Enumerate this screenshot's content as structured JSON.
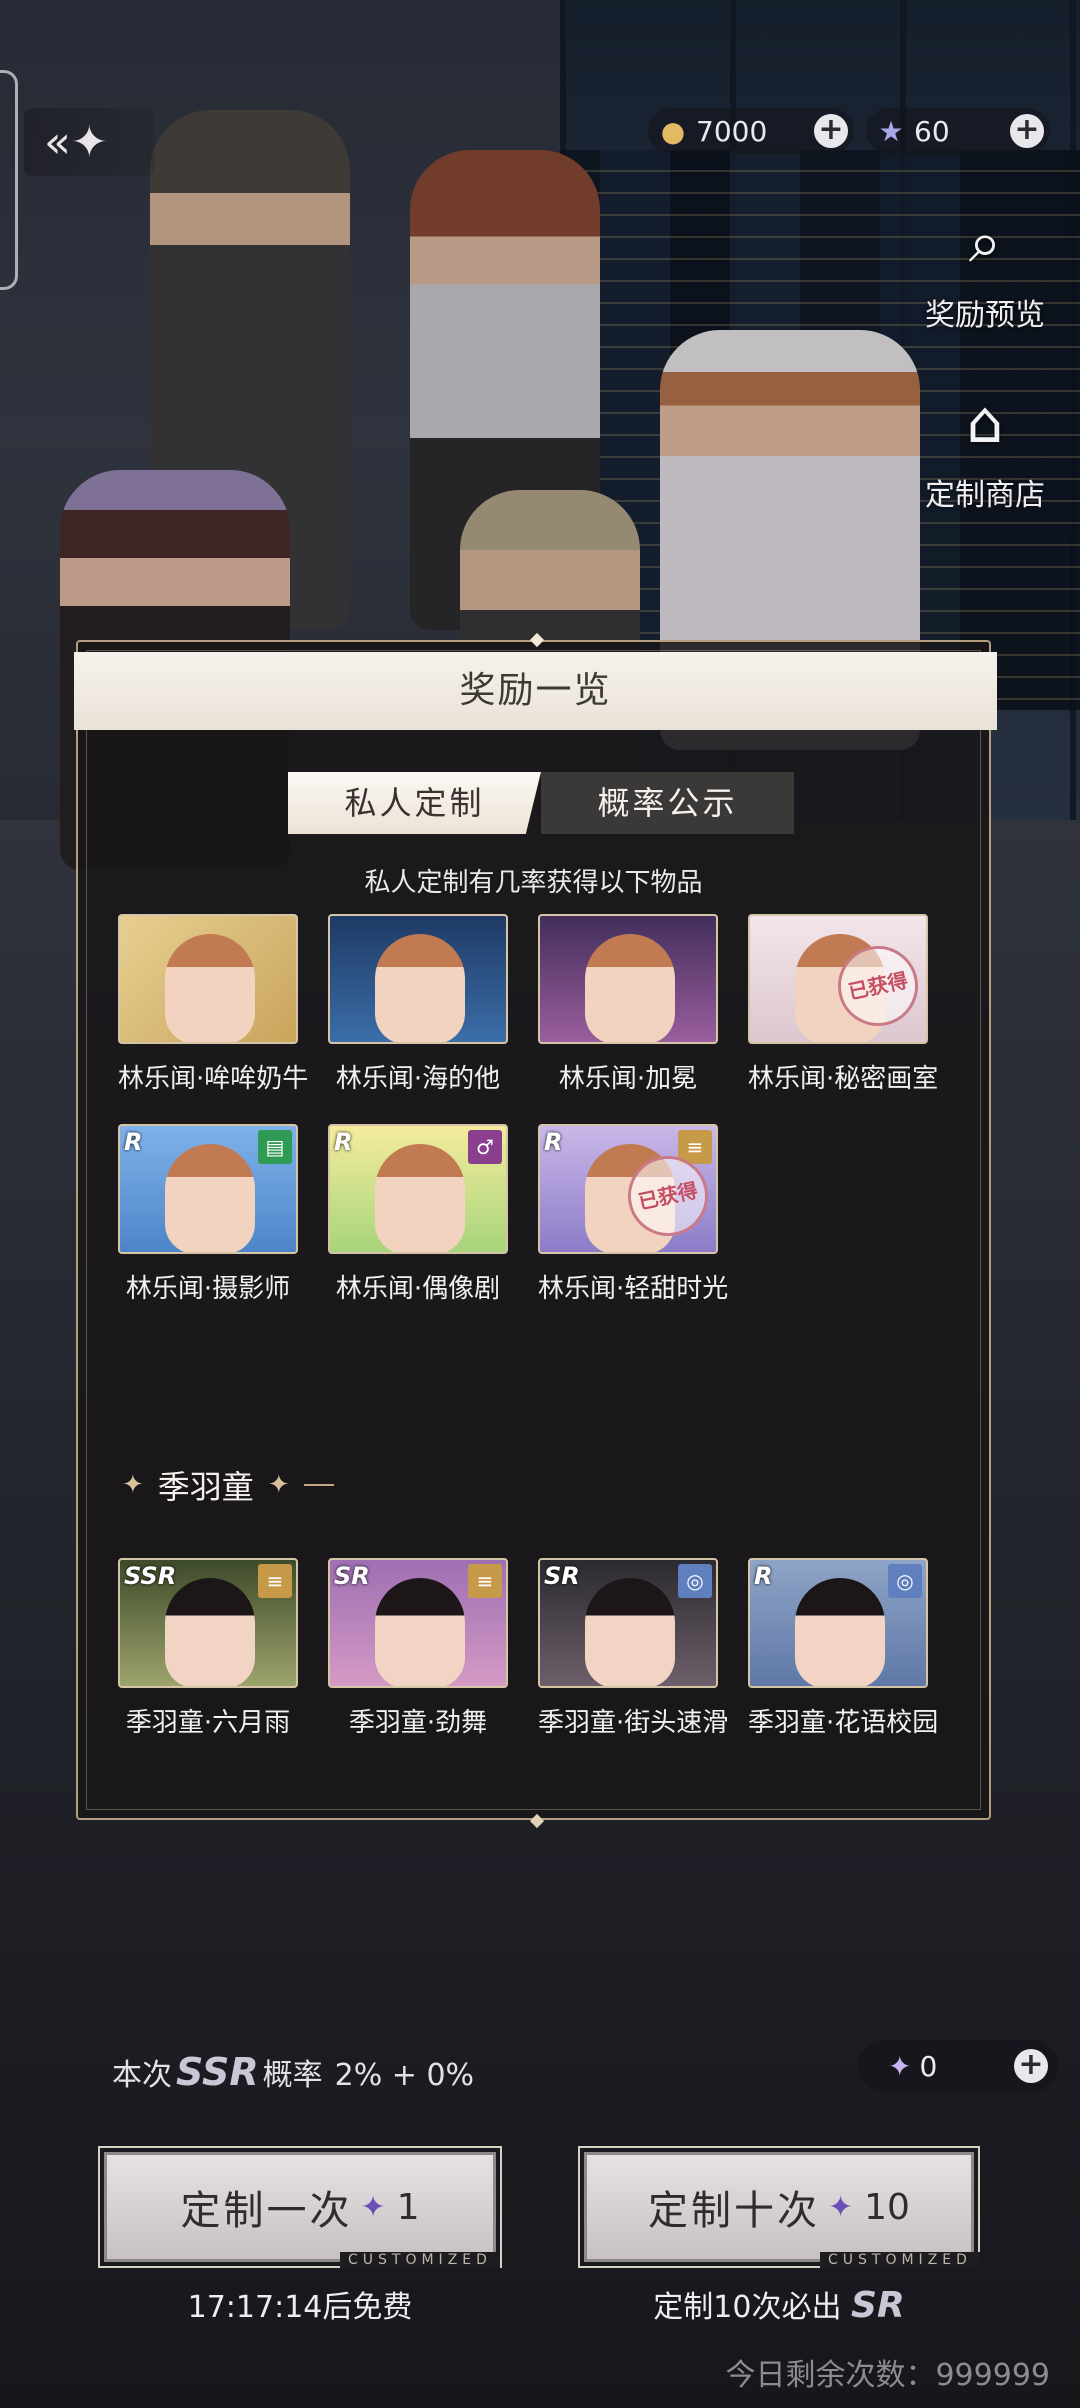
{
  "top_bar": {
    "back_icon": "back-arrow-icon",
    "gold": {
      "icon": "coin-icon",
      "value": "7000",
      "plus": "+"
    },
    "star": {
      "icon": "star-icon",
      "value": "60",
      "plus": "+"
    }
  },
  "side": {
    "preview_label": "奖励预览",
    "shop_label": "定制商店"
  },
  "panel": {
    "title": "奖励一览",
    "tabs": [
      {
        "label": "私人定制",
        "active": true
      },
      {
        "label": "概率公示",
        "active": false
      }
    ],
    "subtitle": "私人定制有几率获得以下物品",
    "owned_stamp": "已获得",
    "group1": [
      {
        "name": "林乐闻·哞哞奶牛",
        "rarity": "",
        "owned": false
      },
      {
        "name": "林乐闻·海的他",
        "rarity": "",
        "owned": false
      },
      {
        "name": "林乐闻·加冕",
        "rarity": "",
        "owned": false
      },
      {
        "name": "林乐闻·秘密画室",
        "rarity": "",
        "owned": true
      },
      {
        "name": "林乐闻·摄影师",
        "rarity": "R",
        "owned": false
      },
      {
        "name": "林乐闻·偶像剧",
        "rarity": "R",
        "owned": false
      },
      {
        "name": "林乐闻·轻甜时光",
        "rarity": "R",
        "owned": true
      }
    ],
    "section2_title": "季羽童",
    "group2": [
      {
        "name": "季羽童·六月雨",
        "rarity": "SSR"
      },
      {
        "name": "季羽童·劲舞",
        "rarity": "SR"
      },
      {
        "name": "季羽童·街头速滑",
        "rarity": "SR"
      },
      {
        "name": "季羽童·花语校园",
        "rarity": "R"
      }
    ]
  },
  "bottom": {
    "prob_prefix": "本次",
    "prob_ssr": "SSR",
    "prob_text": "概率",
    "prob_value": "2% + 0%",
    "ticket_value": "0",
    "ticket_plus": "+",
    "once_label": "定制一次",
    "once_cost": "1",
    "ten_label": "定制十次",
    "ten_cost": "10",
    "customized": "CUSTOMIZED",
    "free_timer": "17:17:14后免费",
    "guarantee_prefix": "定制10次必出",
    "guarantee_rarity": "SR",
    "remaining": "今日剩余次数：999999"
  },
  "colors": {
    "panel_border": "#b59d80",
    "header_bg": "#f6f2ec",
    "tab_inactive": "#3b3838"
  }
}
